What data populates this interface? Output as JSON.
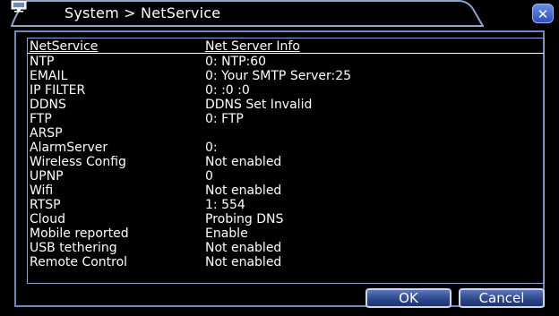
{
  "window": {
    "title": "System > NetService",
    "close_label": "✕"
  },
  "table": {
    "headers": [
      "NetService",
      "Net Server Info"
    ],
    "rows": [
      {
        "service": "NTP",
        "info": "0: NTP:60"
      },
      {
        "service": "EMAIL",
        "info": "0: Your SMTP Server:25"
      },
      {
        "service": "IP FILTER",
        "info": "0: :0 :0"
      },
      {
        "service": "DDNS",
        "info": "DDNS Set Invalid"
      },
      {
        "service": "FTP",
        "info": "0: FTP"
      },
      {
        "service": "ARSP",
        "info": ""
      },
      {
        "service": "AlarmServer",
        "info": "0:"
      },
      {
        "service": "Wireless Config",
        "info": "Not enabled"
      },
      {
        "service": "UPNP",
        "info": "0"
      },
      {
        "service": "Wifi",
        "info": "Not enabled"
      },
      {
        "service": "RTSP",
        "info": "1: 554"
      },
      {
        "service": "Cloud",
        "info": "Probing DNS"
      },
      {
        "service": "Mobile reported",
        "info": "Enable"
      },
      {
        "service": "USB tethering",
        "info": "Not enabled"
      },
      {
        "service": "Remote Control",
        "info": "Not enabled"
      }
    ]
  },
  "buttons": {
    "ok_label": "OK",
    "cancel_label": "Cancel"
  },
  "colors": {
    "accent": "#2a4588",
    "border": "#6d8ab8",
    "text": "#ffffff",
    "background": "#000000"
  }
}
